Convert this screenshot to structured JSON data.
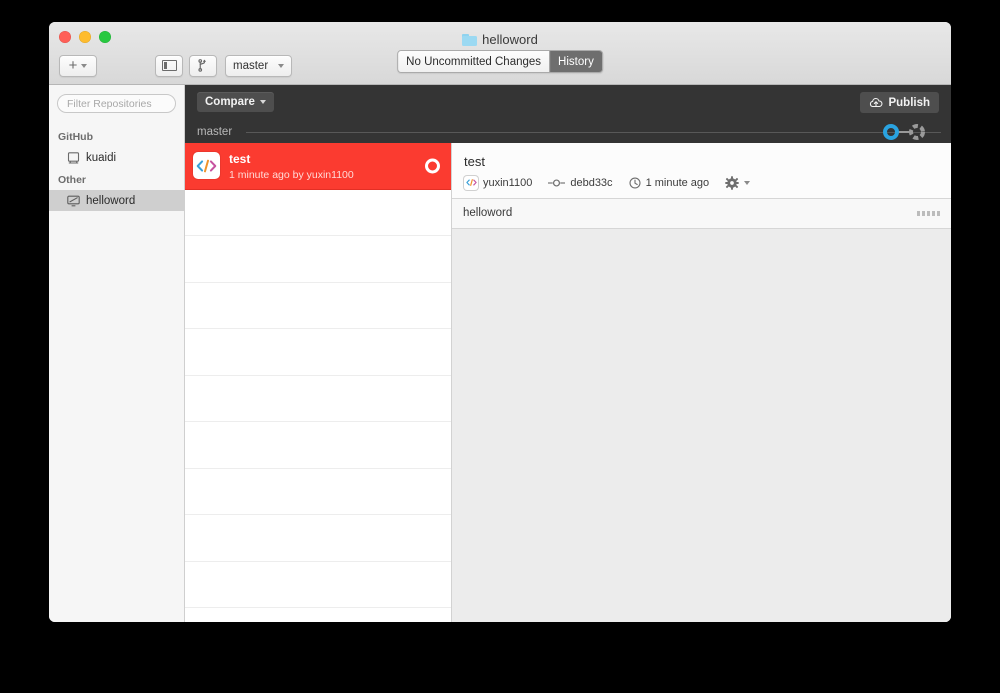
{
  "window": {
    "title": "helloword",
    "title_icon": "folder-icon",
    "traffic_lights": [
      "close-red",
      "minimize-yellow",
      "zoom-green"
    ]
  },
  "toolbar": {
    "add_button": {
      "label": "+",
      "icon": "plus-icon",
      "dropdown_icon": "chevron-down-icon"
    },
    "sidebar_toggle_icon": "sidebar-toggle-icon",
    "new_branch_icon": "branch-create-icon",
    "branch_selector": {
      "label": "master",
      "dropdown_icon": "chevron-down-icon"
    },
    "segments": [
      {
        "label": "No Uncommitted Changes",
        "active": false
      },
      {
        "label": "History",
        "active": true
      }
    ]
  },
  "sidebar": {
    "filter": {
      "placeholder": "Filter Repositories",
      "value": ""
    },
    "groups": [
      {
        "label": "GitHub",
        "items": [
          {
            "label": "kuaidi",
            "icon": "repo-book-icon",
            "selected": false
          }
        ]
      },
      {
        "label": "Other",
        "items": [
          {
            "label": "helloword",
            "icon": "local-repo-monitor-icon",
            "selected": true
          }
        ]
      }
    ]
  },
  "history_header": {
    "compare_button": {
      "label": "Compare",
      "dropdown_icon": "chevron-down-icon"
    },
    "publish_button": {
      "label": "Publish",
      "icon": "cloud-upload-icon"
    },
    "branch_label": "master",
    "graph": {
      "nodes": [
        "commit-node-filled",
        "commit-node-uncommitted"
      ],
      "accent": "#2aa3e0"
    }
  },
  "commit_list": {
    "rows": [
      {
        "selected": true,
        "avatar_icon": "code-brackets-avatar",
        "title": "test",
        "subtitle": "1 minute ago by yuxin1100",
        "status_icon": "commit-donut-icon"
      }
    ],
    "empty_row_count": 9
  },
  "commit_detail": {
    "title": "test",
    "author": {
      "name": "yuxin1100",
      "avatar_icon": "code-brackets-avatar"
    },
    "sha": {
      "value": "debd33c",
      "icon": "commit-node-icon"
    },
    "time": {
      "value": "1 minute ago",
      "icon": "clock-icon"
    },
    "actions": {
      "icon": "gear-icon",
      "dropdown_icon": "chevron-down-icon"
    },
    "files": [
      {
        "name": "helloword",
        "handle_icon": "grip-dots-icon"
      }
    ]
  },
  "colors": {
    "selection_red": "#fb3b30",
    "dark_header": "#343434",
    "accent_blue": "#2aa3e0",
    "diff_background": "#ececec"
  }
}
